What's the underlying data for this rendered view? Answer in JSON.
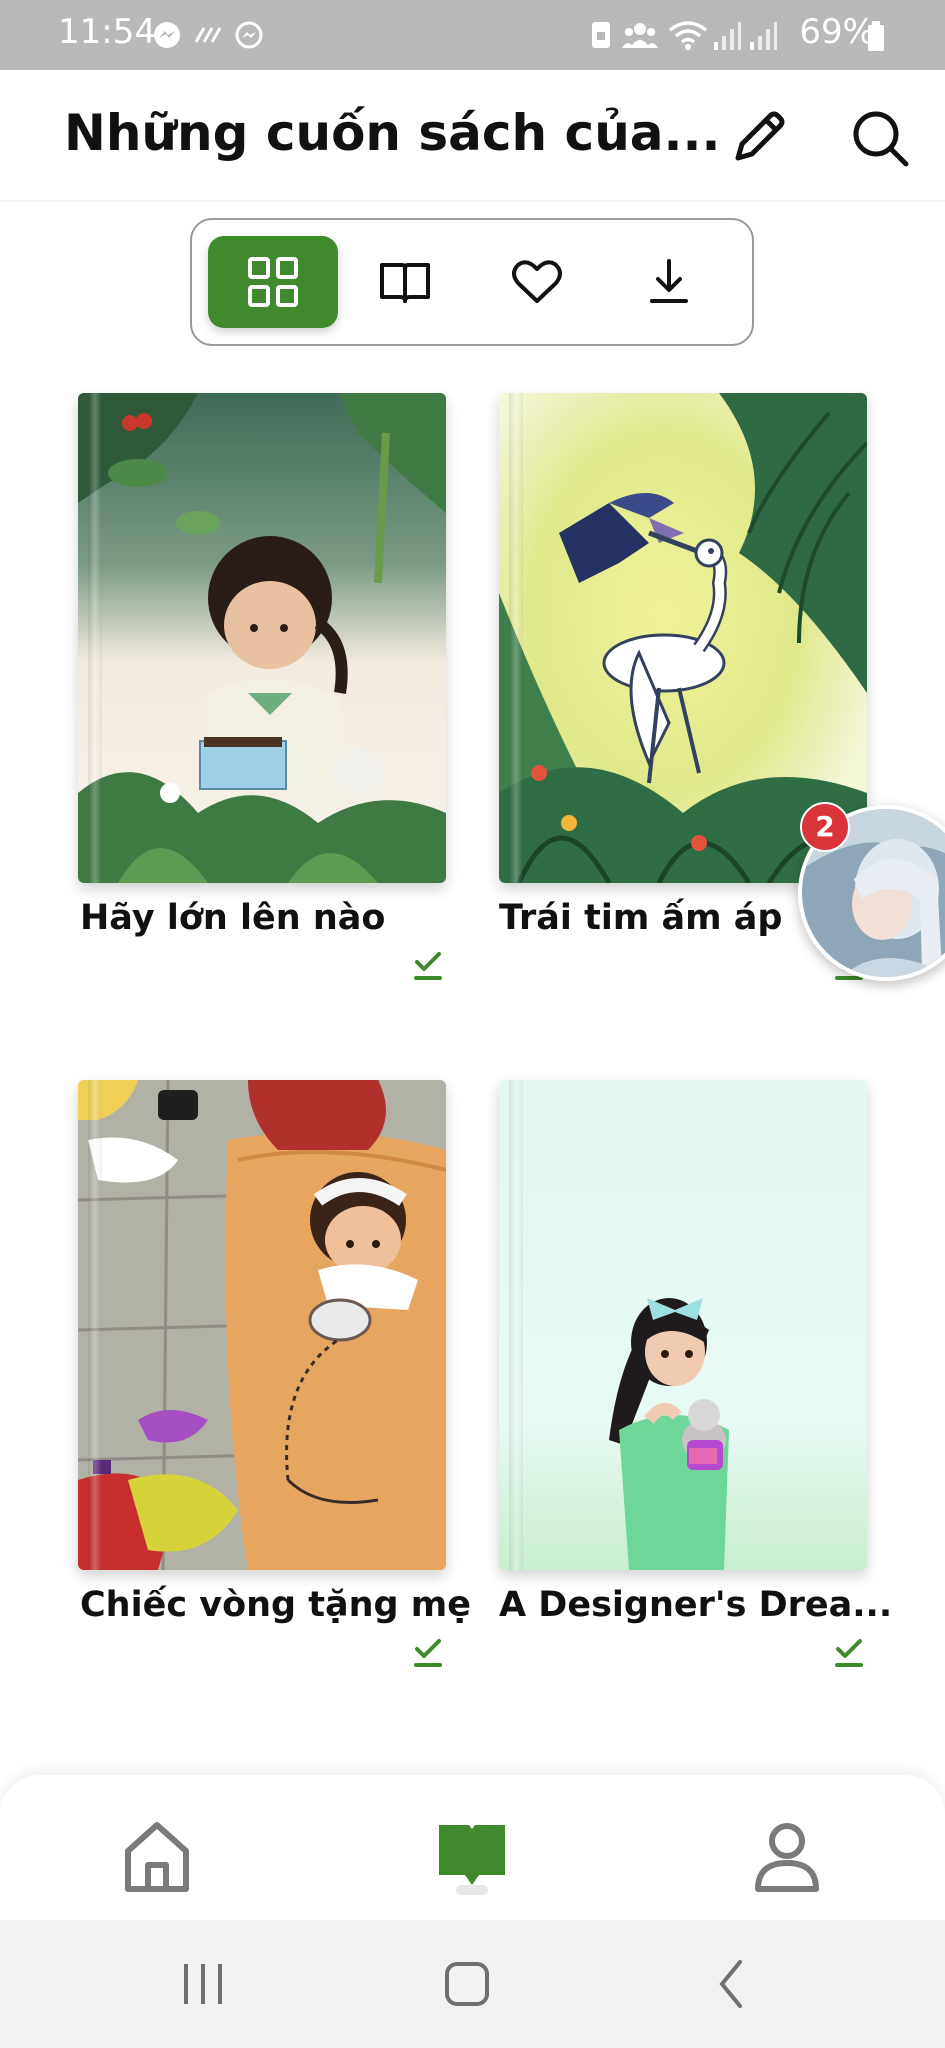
{
  "status_bar": {
    "time": "11:54",
    "battery": "69%",
    "left_icons": [
      "messenger-icon",
      "missed-call-icon",
      "messenger-icon"
    ],
    "right_icons": [
      "sim-icon",
      "group-icon",
      "wifi-icon",
      "signal-icon",
      "signal-icon",
      "battery-icon"
    ]
  },
  "header": {
    "title": "Những cuốn sách của...",
    "edit_icon": "pencil-icon",
    "search_icon": "search-icon"
  },
  "view_tabs": {
    "items": [
      {
        "icon": "grid-icon",
        "active": true
      },
      {
        "icon": "open-book-icon",
        "active": false
      },
      {
        "icon": "heart-icon",
        "active": false
      },
      {
        "icon": "download-icon",
        "active": false
      }
    ]
  },
  "books": [
    {
      "title": "Hãy lớn lên nào",
      "downloaded": true
    },
    {
      "title": "Trái tim ấm áp",
      "downloaded": true
    },
    {
      "title": "Chiếc vòng tặng mẹ",
      "downloaded": true
    },
    {
      "title": "A Designer's Drea...",
      "downloaded": true
    }
  ],
  "floating_bubble": {
    "badge_count": "2"
  },
  "bottom_nav": {
    "items": [
      {
        "icon": "home-icon",
        "active": false
      },
      {
        "icon": "library-book-icon",
        "active": true
      },
      {
        "icon": "profile-icon",
        "active": false
      }
    ]
  },
  "colors": {
    "accent": "#3f8a2d",
    "badge": "#d8343a",
    "status_bar": "#b9b9b9"
  }
}
